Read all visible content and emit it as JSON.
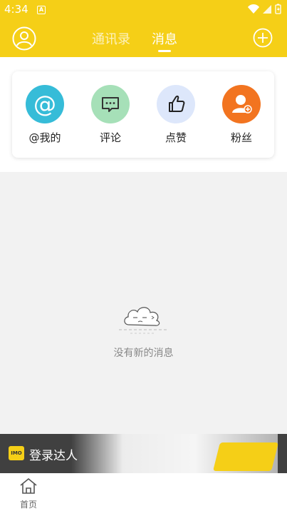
{
  "status_bar": {
    "time": "4:34",
    "notification_letter": "A"
  },
  "header": {
    "tabs": [
      {
        "label": "通讯录"
      },
      {
        "label": "消息"
      }
    ],
    "active_tab": "消息",
    "color": "#f5cf17"
  },
  "message_categories": [
    {
      "label": "@我的",
      "icon": "at-icon",
      "color": "#36bcd8"
    },
    {
      "label": "评论",
      "icon": "comment-icon",
      "color": "#a6e0b8"
    },
    {
      "label": "点赞",
      "icon": "thumbs-up-icon",
      "color": "#dde7fb"
    },
    {
      "label": "粉丝",
      "icon": "fans-icon",
      "color": "#f27420"
    }
  ],
  "empty_state": {
    "text": "没有新的消息",
    "icon": "cloud-icon"
  },
  "banner": {
    "logo_text": "IMO馆",
    "text": "登录达人"
  },
  "bottom_nav": {
    "home_label": "首页"
  }
}
